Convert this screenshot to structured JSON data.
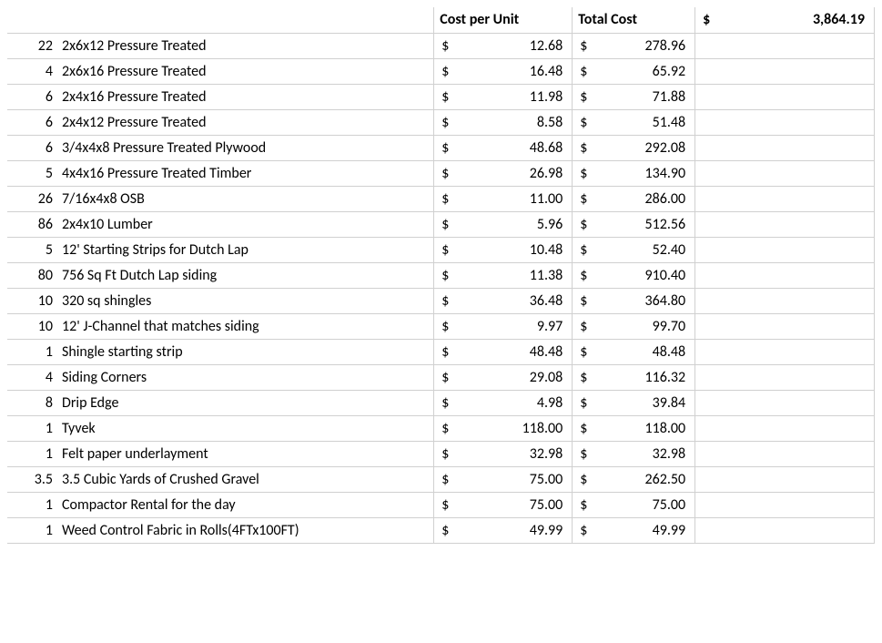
{
  "headers": {
    "cost_per_unit": "Cost per Unit",
    "total_cost": "Total Cost"
  },
  "currency_symbol": "$",
  "grand_total": "3,864.19",
  "rows": [
    {
      "qty": "22",
      "desc": "2x6x12 Pressure Treated",
      "unit": "12.68",
      "total": "278.96"
    },
    {
      "qty": "4",
      "desc": "2x6x16 Pressure Treated",
      "unit": "16.48",
      "total": "65.92"
    },
    {
      "qty": "6",
      "desc": "2x4x16 Pressure Treated",
      "unit": "11.98",
      "total": "71.88"
    },
    {
      "qty": "6",
      "desc": "2x4x12 Pressure Treated",
      "unit": "8.58",
      "total": "51.48"
    },
    {
      "qty": "6",
      "desc": "3/4x4x8 Pressure Treated Plywood",
      "unit": "48.68",
      "total": "292.08"
    },
    {
      "qty": "5",
      "desc": "4x4x16 Pressure Treated Timber",
      "unit": "26.98",
      "total": "134.90"
    },
    {
      "qty": "26",
      "desc": "7/16x4x8 OSB",
      "unit": "11.00",
      "total": "286.00"
    },
    {
      "qty": "86",
      "desc": "2x4x10 Lumber",
      "unit": "5.96",
      "total": "512.56"
    },
    {
      "qty": "5",
      "desc": "12' Starting Strips for Dutch Lap",
      "unit": "10.48",
      "total": "52.40"
    },
    {
      "qty": "80",
      "desc": "756 Sq Ft Dutch Lap siding",
      "unit": "11.38",
      "total": "910.40"
    },
    {
      "qty": "10",
      "desc": "320 sq shingles",
      "unit": "36.48",
      "total": "364.80"
    },
    {
      "qty": "10",
      "desc": "12' J-Channel that matches siding",
      "unit": "9.97",
      "total": "99.70"
    },
    {
      "qty": "1",
      "desc": "Shingle starting strip",
      "unit": "48.48",
      "total": "48.48"
    },
    {
      "qty": "4",
      "desc": "Siding Corners",
      "unit": "29.08",
      "total": "116.32"
    },
    {
      "qty": "8",
      "desc": "Drip Edge",
      "unit": "4.98",
      "total": "39.84"
    },
    {
      "qty": "1",
      "desc": "Tyvek",
      "unit": "118.00",
      "total": "118.00"
    },
    {
      "qty": "1",
      "desc": "Felt paper underlayment",
      "unit": "32.98",
      "total": "32.98"
    },
    {
      "qty": "3.5",
      "desc": "3.5 Cubic Yards of Crushed Gravel",
      "unit": "75.00",
      "total": "262.50"
    },
    {
      "qty": "1",
      "desc": "Compactor Rental for the day",
      "unit": "75.00",
      "total": "75.00"
    },
    {
      "qty": "1",
      "desc": "Weed Control Fabric in Rolls(4FTx100FT)",
      "unit": "49.99",
      "total": "49.99"
    }
  ]
}
